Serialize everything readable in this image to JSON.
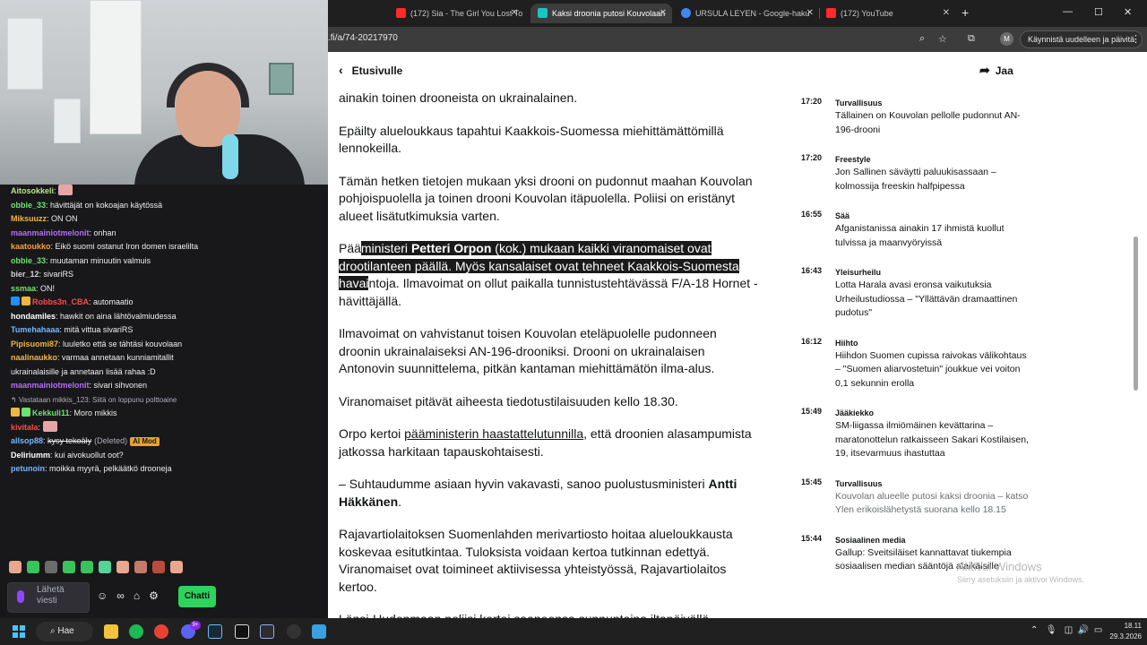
{
  "chat": {
    "messages": [
      {
        "user": "Aitosokkeli",
        "color": "#b8e986",
        "text": "",
        "emote": true
      },
      {
        "user": "obbie_33",
        "color": "#6fe36f",
        "text": "hävittäjät on kokoajan käytössä"
      },
      {
        "user": "Miksuuzz",
        "color": "#f0b640",
        "text": "ON ON"
      },
      {
        "user": "maanmainiotmelonit",
        "color": "#b46ff5",
        "text": "onhan"
      },
      {
        "user": "kaatoukko",
        "color": "#f7a23b",
        "text": "Eikö suomi ostanut Iron domen israelilta"
      },
      {
        "user": "obbie_33",
        "color": "#6fe36f",
        "text": "muutaman minuutin valmuis"
      },
      {
        "user": "bier_12",
        "color": "#d3d3d3",
        "text": "sivariRS"
      },
      {
        "user": "ssmaa",
        "color": "#6fe36f",
        "text": "ON!"
      },
      {
        "user": "Robbs3n_CBA",
        "color": "#ff4a4a",
        "text": "automaatio",
        "badges": true
      },
      {
        "user": "hondamiles",
        "color": "#ffffff",
        "text": "hawkit on aina lähtövalmiudessa"
      },
      {
        "user": "Tumehahaaa",
        "color": "#76b7ff",
        "text": "mitä vittua sivariRS"
      },
      {
        "user": "Pipisuomi87",
        "color": "#f0b640",
        "text": "luuletko että se tähtäsi kouvolaan"
      },
      {
        "user": "naalinaukko",
        "color": "#f0b640",
        "text": "varmaa annetaan kunniamitallit"
      },
      {
        "user": "",
        "color": "#efeff1",
        "text": "ukrainalaisille ja annetaan lisää rahaa :D"
      },
      {
        "user": "maanmainiotmelonit",
        "color": "#b46ff5",
        "text": "sivari sihvonen"
      },
      {
        "user": "",
        "color": "#adadb8",
        "text": "↰ Vastataan mikkis_123: Siitä on loppunu polttoaine",
        "small": true
      },
      {
        "user": "Kekkuli11",
        "color": "#6fe36f",
        "text": "Moro mikkis",
        "badges": true
      },
      {
        "user": "kivitala",
        "color": "#ff4a4a",
        "text": "",
        "emote": true
      },
      {
        "user": "allsop88",
        "color": "#76b7ff",
        "text": "kysy tekoäly",
        "deleted": "(Deleted)",
        "mod": "AI Mod"
      },
      {
        "user": "Deliriumm",
        "color": "#ffffff",
        "text": "kui aivokuollut oot?"
      },
      {
        "user": "petunoin",
        "color": "#76b7ff",
        "text": "moikka myyrä, pelkäätkö drooneja"
      }
    ],
    "input_placeholder": "Lähetä viesti",
    "send_label": "Chatti"
  },
  "browser": {
    "tabs": [
      {
        "label": "(172) Sia - The Girl You Lost To",
        "fav_color": "#ff2a2a"
      },
      {
        "label": "Kaksi droonia putosi Kouvolaan",
        "fav_color": "#19c4c4",
        "active": true
      },
      {
        "label": "URSULA LEYEN - Google-haku",
        "fav_color": "#4285f4"
      },
      {
        "label": "(172) YouTube",
        "fav_color": "#ff2a2a"
      }
    ],
    "url": ".fi/a/74-20217970",
    "restart_label": "Käynnistä uudelleen ja päivitä",
    "profile_initial": "M"
  },
  "page": {
    "back_label": "Etusivulle",
    "share_label": "Jaa",
    "article": {
      "p1": "ainakin toinen drooneista on ukrainalainen.",
      "p2": "Epäilty alueloukkaus tapahtui Kaakkois-Suomessa miehittämättömillä lennokeilla.",
      "p3": "Tämän hetken tietojen mukaan yksi drooni on pudonnut maahan Kouvolan pohjoispuolella ja toinen drooni Kouvolan itäpuolella. Poliisi on eristänyt alueet lisätutkimuksia varten.",
      "p4_a": "Pää",
      "p4_hl1": "ministeri ",
      "p4_bold": "Petteri Orpon",
      "p4_hl2": " (kok.) mukaan kaikki viranomaiset ovat",
      "p4_hl3": "tilanteen päällä. Myös kansalaiset ovat tehneet Kaakkois-Suomesta",
      "p4_hl3_pre": "droo",
      "p4_hl4": "havai",
      "p4_rest": "ntoja. Ilmavoimat on ollut paikalla tunnistustehtävässä F/A-18 Hornet -hävittäjällä.",
      "p5": "Ilmavoimat on vahvistanut toisen Kouvolan eteläpuolelle pudonneen droonin ukrainalaiseksi AN-196-drooniksi. Drooni on ukrainalaisen Antonovin suunnittelema, pitkän kantaman miehittämätön ilma-alus.",
      "p6": "Viranomaiset pitävät aiheesta tiedotustilaisuuden kello 18.30.",
      "p7_a": "Orpo kertoi ",
      "p7_link": "pääministerin haastattelutunnilla",
      "p7_b": ", että droonien alasampumista jatkossa harkitaan tapauskohtaisesti.",
      "p8_a": "– Suhtaudumme asiaan hyvin vakavasti, sanoo puolustusministeri ",
      "p8_bold": "Antti Häkkänen",
      "p8_b": ".",
      "p9": "Rajavartiolaitoksen Suomenlahden merivartiosto hoitaa alueloukkausta koskevaa esitutkintaa. Tuloksista voidaan kertoa tutkinnan edettyä. Viranomaiset ovat toimineet aktiivisessa yhteistyössä, Rajavartiolaitos kertoo.",
      "p10": "Länsi-Uudenmaan poliisi kertoi saaneensa sunnuntaina iltapäivällä"
    },
    "feed": [
      {
        "time": "17:20",
        "cat": "Turvallisuus",
        "headline": "Tällainen on Kouvolan pellolle pudonnut AN-196-drooni"
      },
      {
        "time": "17:20",
        "cat": "Freestyle",
        "headline": "Jon Sallinen säväytti paluukisassaan – kolmossija freeskin halfpipessa"
      },
      {
        "time": "16:55",
        "cat": "Sää",
        "headline": "Afganistanissa ainakin 17 ihmistä kuollut tulvissa ja maanvyöryissä"
      },
      {
        "time": "16:43",
        "cat": "Yleisurheilu",
        "headline": "Lotta Harala avasi eronsa vaikutuksia Urheilustudiossa – \"Yllättävän dramaattinen pudotus\""
      },
      {
        "time": "16:12",
        "cat": "Hiihto",
        "headline": "Hiihdon Suomen cupissa raivokas välikohtaus – \"Suomen aliarvostetuin\" joukkue vei voiton 0,1 sekunnin erolla"
      },
      {
        "time": "15:49",
        "cat": "Jääkiekko",
        "headline": "SM-liigassa ilmiömäinen kevättarina – maratonottelun ratkaisseen Sakari Kostilaisen, 19, itsevarmuus ihastuttaa"
      },
      {
        "time": "15:45",
        "cat": "Turvallisuus",
        "headline": "Kouvolan alueelle putosi kaksi droonia – katso Ylen erikoislähetystä suorana kello 18.15",
        "muted": true
      },
      {
        "time": "15:44",
        "cat": "Sosiaalinen media",
        "headline": "Gallup: Sveitsiläiset kannattavat tiukempia sosiaalisen median sääntöjä alaikäisille"
      }
    ],
    "activate_title": "Aktivoi Windows",
    "activate_sub": "Siirry asetuksiin ja aktivoi Windows."
  },
  "taskbar": {
    "search_label": "Hae",
    "badge_count": "9+",
    "clock_time": "18.11",
    "clock_date": "29.3.2026"
  }
}
